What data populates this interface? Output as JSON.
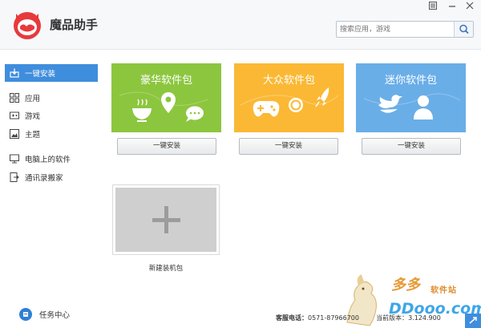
{
  "app": {
    "title": "魔品助手"
  },
  "window": {
    "menu_icon": "menu-icon",
    "minimize_icon": "minimize-icon",
    "close_icon": "close-icon"
  },
  "search": {
    "placeholder": "搜索应用，游戏",
    "icon": "search-icon"
  },
  "sidebar": {
    "items": [
      {
        "label": "一键安装",
        "icon": "one-click-install-icon",
        "active": true
      },
      {
        "label": "应用",
        "icon": "apps-grid-icon"
      },
      {
        "label": "游戏",
        "icon": "game-icon"
      },
      {
        "label": "主题",
        "icon": "theme-icon"
      },
      {
        "label": "电脑上的软件",
        "icon": "computer-icon"
      },
      {
        "label": "通讯录搬家",
        "icon": "contacts-move-icon"
      }
    ],
    "task_center": "任务中心"
  },
  "packages": [
    {
      "title": "豪华软件包",
      "button": "一键安装",
      "color": "#8cc63f"
    },
    {
      "title": "大众软件包",
      "button": "一键安装",
      "color": "#fbb834"
    },
    {
      "title": "迷你软件包",
      "button": "一键安装",
      "color": "#6aaee8"
    }
  ],
  "new_package": {
    "label": "新建装机包"
  },
  "status": {
    "hotline_label": "客服电话：",
    "hotline": "0571-87966700",
    "version_label": "当前版本：",
    "version": "3.124.900"
  },
  "watermark": {
    "text1": "多多",
    "text2": "软件站",
    "text3": "DDooo.com"
  }
}
